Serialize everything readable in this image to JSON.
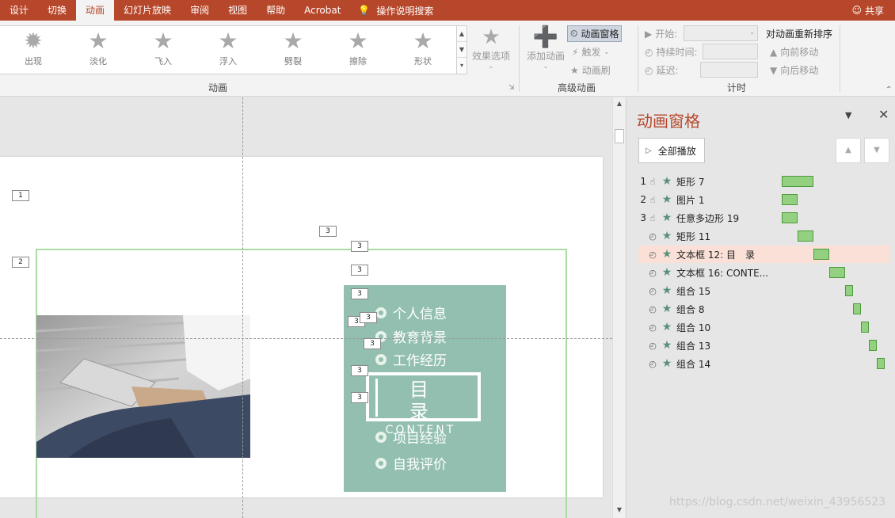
{
  "tabs": [
    "设计",
    "切换",
    "动画",
    "幻灯片放映",
    "审阅",
    "视图",
    "帮助",
    "Acrobat"
  ],
  "active_tab": "动画",
  "tell_me": "操作说明搜索",
  "share": "共享",
  "gallery": [
    "出现",
    "淡化",
    "飞入",
    "浮入",
    "劈裂",
    "擦除",
    "形状"
  ],
  "groups": {
    "animation": "动画",
    "advanced": "高级动画",
    "timing": "计时"
  },
  "effect_options": "效果选项",
  "add_animation": "添加动画",
  "animation_pane_btn": "动画窗格",
  "trigger": "触发",
  "animation_painter": "动画刷",
  "start_label": "开始:",
  "duration_label": "持续时间:",
  "delay_label": "延迟:",
  "reorder": {
    "title": "对动画重新排序",
    "forward": "向前移动",
    "backward": "向后移动"
  },
  "slide": {
    "tag_1": "1",
    "tag_2": "2",
    "tag_3": "3",
    "menu": [
      "个人信息",
      "教育背景",
      "工作经历",
      "项目经验",
      "自我评价"
    ],
    "mulu_title": "目 录",
    "mulu_sub": "CONTENT"
  },
  "pane": {
    "title": "动画窗格",
    "play_all": "全部播放",
    "items": [
      {
        "num": "1",
        "trigger": "click",
        "name": "矩形 7",
        "bar_start": 0,
        "bar_len": 40
      },
      {
        "num": "2",
        "trigger": "click",
        "name": "图片 1",
        "bar_start": 0,
        "bar_len": 20
      },
      {
        "num": "3",
        "trigger": "click",
        "name": "任意多边形 19",
        "bar_start": 0,
        "bar_len": 20
      },
      {
        "num": "",
        "trigger": "after",
        "name": "矩形 11",
        "bar_start": 20,
        "bar_len": 20
      },
      {
        "num": "",
        "trigger": "after",
        "name": "文本框 12: 目　录",
        "bar_start": 40,
        "bar_len": 20,
        "selected": true
      },
      {
        "num": "",
        "trigger": "after",
        "name": "文本框 16: CONTE...",
        "bar_start": 60,
        "bar_len": 20
      },
      {
        "num": "",
        "trigger": "after",
        "name": "组合 15",
        "bar_start": 80,
        "bar_len": 10
      },
      {
        "num": "",
        "trigger": "after",
        "name": "组合 8",
        "bar_start": 90,
        "bar_len": 10
      },
      {
        "num": "",
        "trigger": "after",
        "name": "组合 10",
        "bar_start": 100,
        "bar_len": 10
      },
      {
        "num": "",
        "trigger": "after",
        "name": "组合 13",
        "bar_start": 110,
        "bar_len": 10
      },
      {
        "num": "",
        "trigger": "after",
        "name": "组合 14",
        "bar_start": 120,
        "bar_len": 10
      }
    ]
  },
  "watermark": "https://blog.csdn.net/weixin_43956523"
}
